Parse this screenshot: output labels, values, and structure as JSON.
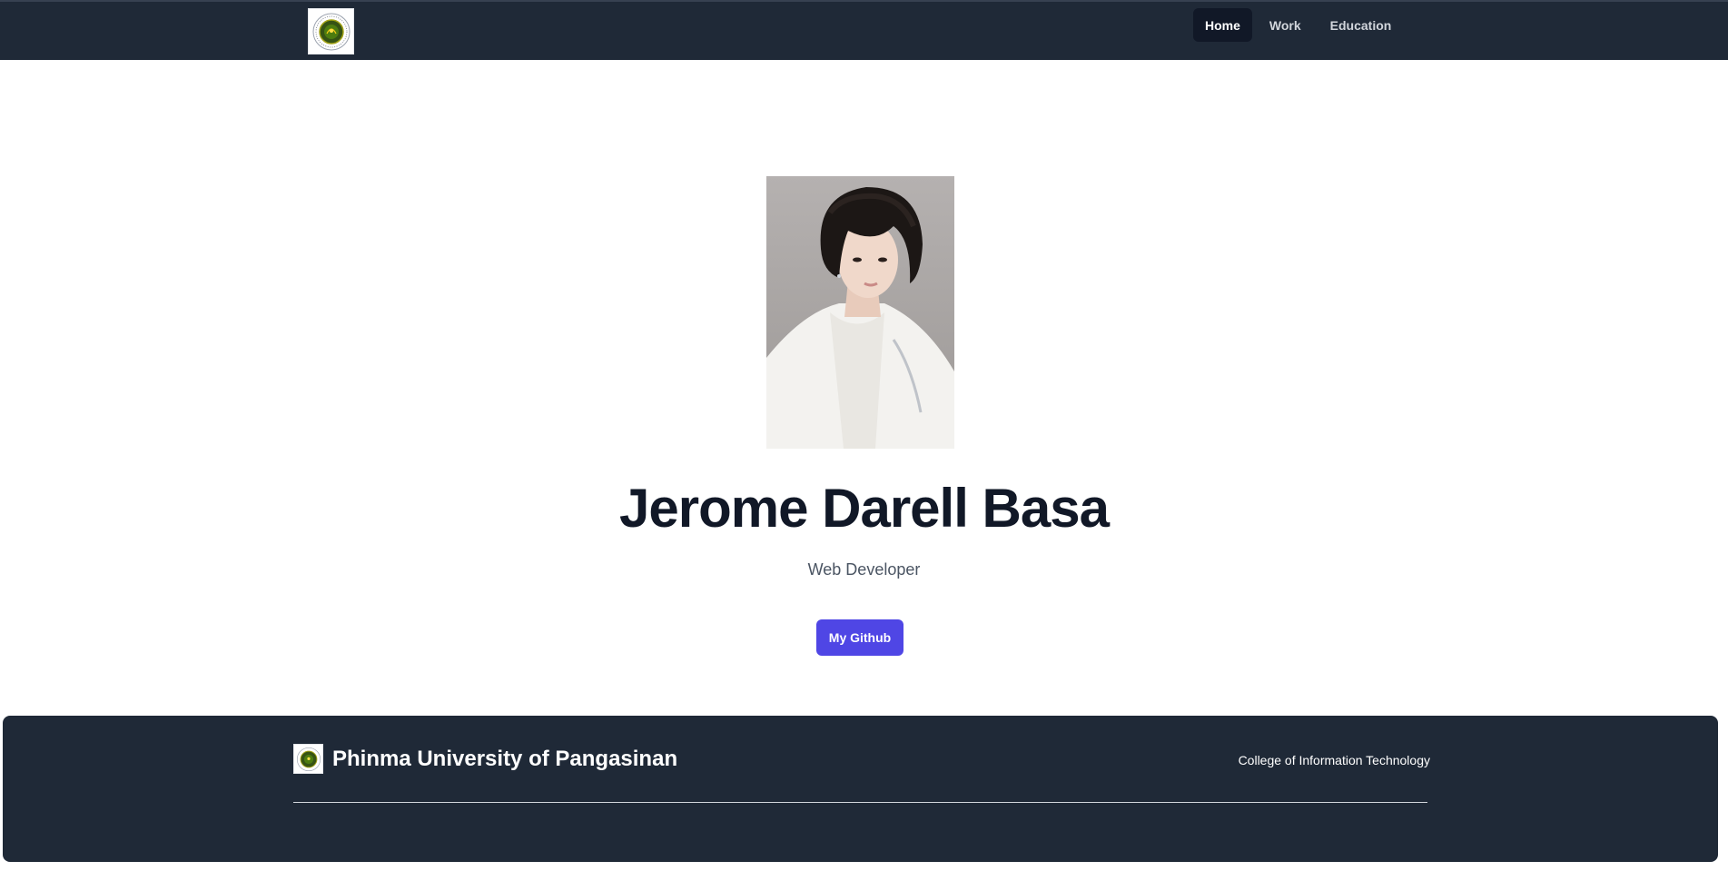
{
  "nav": {
    "logo_icon": "university-seal-icon",
    "links": [
      {
        "label": "Home",
        "active": true
      },
      {
        "label": "Work",
        "active": false
      },
      {
        "label": "Education",
        "active": false
      }
    ]
  },
  "hero": {
    "photo_icon": "profile-photo",
    "name": "Jerome Darell Basa",
    "role": "Web Developer",
    "button_label": "My Github"
  },
  "footer": {
    "logo_icon": "university-seal-icon",
    "title": "Phinma University of Pangasinan",
    "college": "College of Information Technology"
  },
  "colors": {
    "nav_bg": "#1f2937",
    "active_link_bg": "#111827",
    "button_bg": "#4f46e5",
    "heading": "#111827",
    "footer_bg": "#1f2937"
  }
}
